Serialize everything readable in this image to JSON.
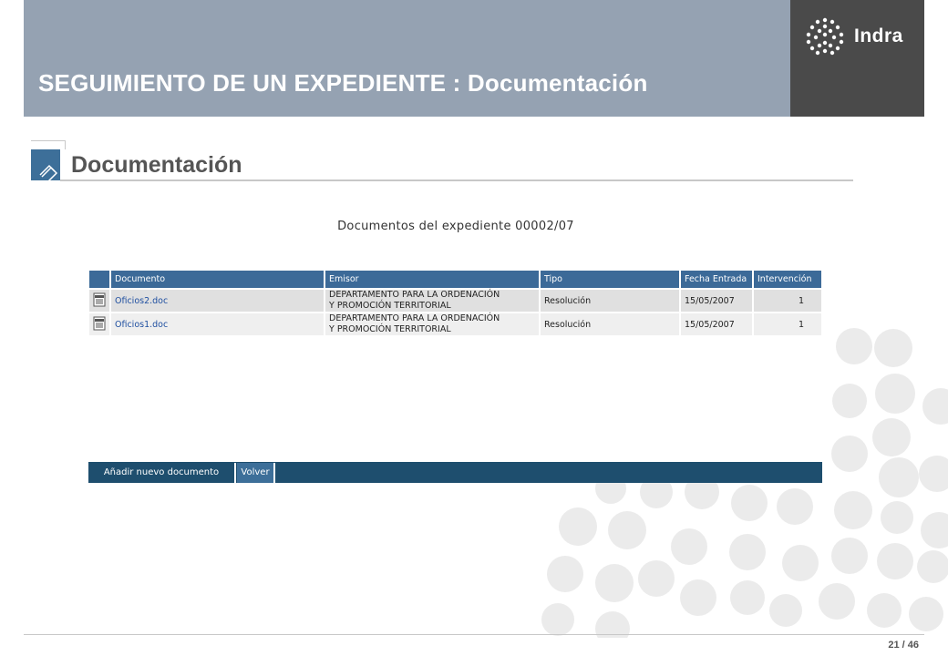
{
  "header": {
    "title": "SEGUIMIENTO DE UN EXPEDIENTE : Documentación",
    "logo_text": "Indra"
  },
  "section": {
    "title": "Documentación"
  },
  "caption": "Documentos del expediente 00002/07",
  "table": {
    "headers": [
      "",
      "Documento",
      "Emisor",
      "Tipo",
      "Fecha Entrada",
      "Intervención"
    ],
    "rows": [
      {
        "documento": "Oficios2.doc",
        "emisor_line1": "DEPARTAMENTO PARA LA ORDENACIÓN",
        "emisor_line2": "Y PROMOCIÓN TERRITORIAL",
        "tipo": "Resolución",
        "fecha": "15/05/2007",
        "intervencion": "1"
      },
      {
        "documento": "Oficios1.doc",
        "emisor_line1": "DEPARTAMENTO PARA LA ORDENACIÓN",
        "emisor_line2": "Y PROMOCIÓN TERRITORIAL",
        "tipo": "Resolución",
        "fecha": "15/05/2007",
        "intervencion": "1"
      }
    ]
  },
  "actions": {
    "add_label": "Añadir nuevo documento",
    "back_label": "Volver"
  },
  "footer": {
    "page": "21 / 46"
  },
  "colors": {
    "header_band": "#95a2b2",
    "logo_box": "#4a4a4a",
    "table_header": "#3c6a98",
    "action_bar": "#1e4e6e",
    "link": "#1f4fa0"
  },
  "icons": {
    "doc_icon": "document-icon",
    "section_icon": "diamond-icon"
  }
}
